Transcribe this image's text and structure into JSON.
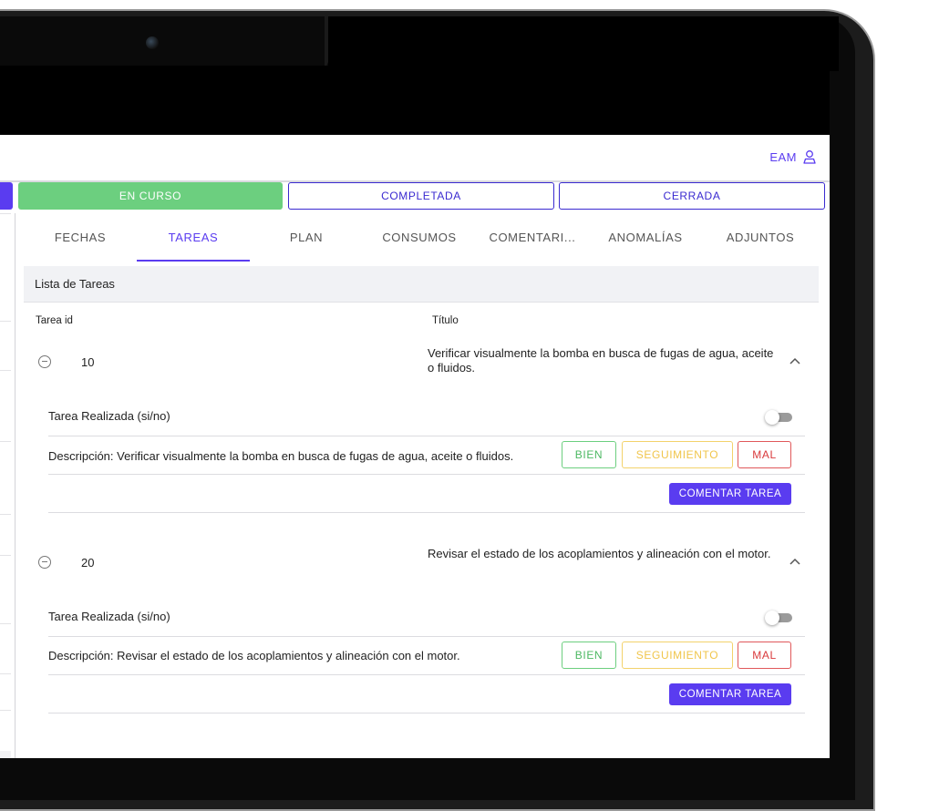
{
  "header": {
    "user_label": "EAM"
  },
  "status": {
    "en_curso": "EN CURSO",
    "completada": "COMPLETADA",
    "cerrada": "CERRADA"
  },
  "tabs": [
    {
      "label": "FECHAS"
    },
    {
      "label": "TAREAS",
      "active": true
    },
    {
      "label": "PLAN"
    },
    {
      "label": "CONSUMOS"
    },
    {
      "label": "COMENTARI..."
    },
    {
      "label": "ANOMALÍAS"
    },
    {
      "label": "ADJUNTOS"
    }
  ],
  "list": {
    "title": "Lista de Tareas",
    "columns": {
      "id": "Tarea id",
      "title": "Título"
    },
    "tasks": [
      {
        "id": "10",
        "title": "Verificar visualmente la bomba en busca de fugas de agua, aceite o fluidos.",
        "done_label": "Tarea Realizada (si/no)",
        "done": false,
        "description": "Descripción: Verificar visualmente la bomba en busca de fugas de agua, aceite o fluidos.",
        "eval_bien": "BIEN",
        "eval_seguimiento": "SEGUIMIENTO",
        "eval_mal": "MAL",
        "comment_button": "COMENTAR TAREA"
      },
      {
        "id": "20",
        "title": "Revisar el estado de los acoplamientos y alineación con el motor.",
        "done_label": "Tarea Realizada (si/no)",
        "done": false,
        "description": "Descripción: Revisar el estado de los acoplamientos y alineación con el motor.",
        "eval_bien": "BIEN",
        "eval_seguimiento": "SEGUIMIENTO",
        "eval_mal": "MAL",
        "comment_button": "COMENTAR TAREA"
      }
    ]
  },
  "colors": {
    "accent": "#5a3cf0",
    "en_curso": "#6ccf7f",
    "bien": "#6ccf7f",
    "seguimiento": "#f3d26b",
    "mal": "#e0585a"
  }
}
